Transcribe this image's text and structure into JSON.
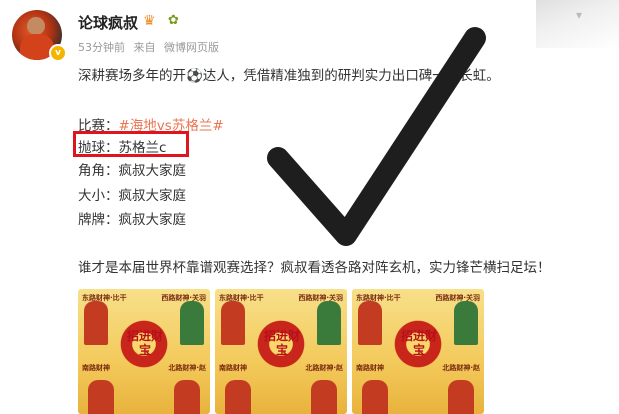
{
  "post": {
    "username": "论球疯叔",
    "time": "53分钟前",
    "source_prefix": "来自",
    "source": "微博网页版",
    "intro": "深耕赛场多年的开⚽达人，凭借精准独到的研判实力出",
    "intro_tail": "口碑一路长虹。",
    "match_label": "比赛：",
    "match_tag": "#海地vs苏格兰#",
    "tip_label": "抛球：",
    "tip_value": "苏格兰c",
    "corner_label": "角角：",
    "corner_value": "疯叔大家庭",
    "size_label": "大小：",
    "size_value": "疯叔大家庭",
    "card_label": "牌牌：",
    "card_value": "疯叔大家庭",
    "closing": "谁才是本届世界杯靠谱观赛选择？疯叔看透各路对阵玄机，实力锋芒横扫足坛！"
  },
  "images": [
    {
      "center_text": "招进财宝",
      "top_left": "东路财神·比干",
      "top_right": "西路财神·关羽",
      "bottom_left": "南路财神",
      "bottom_right": "北路财神·赵"
    },
    {
      "center_text": "招进财宝",
      "top_left": "东路财神·比干",
      "top_right": "西路财神·关羽",
      "bottom_left": "南路财神",
      "bottom_right": "北路财神·赵"
    },
    {
      "center_text": "招进财宝",
      "top_left": "东路财神·比干",
      "top_right": "西路财神·关羽",
      "bottom_left": "南路财神",
      "bottom_right": "北路财神·赵"
    }
  ],
  "icons": {
    "verified": "verified-badge-icon",
    "crown": "crown-icon",
    "fan": "fan-badge-icon",
    "more": "more-icon",
    "checkmark": "checkmark-icon"
  },
  "colors": {
    "hashtag": "#eb7350",
    "highlight_border": "#e0141e",
    "checkmark": "#1e1e1e"
  }
}
